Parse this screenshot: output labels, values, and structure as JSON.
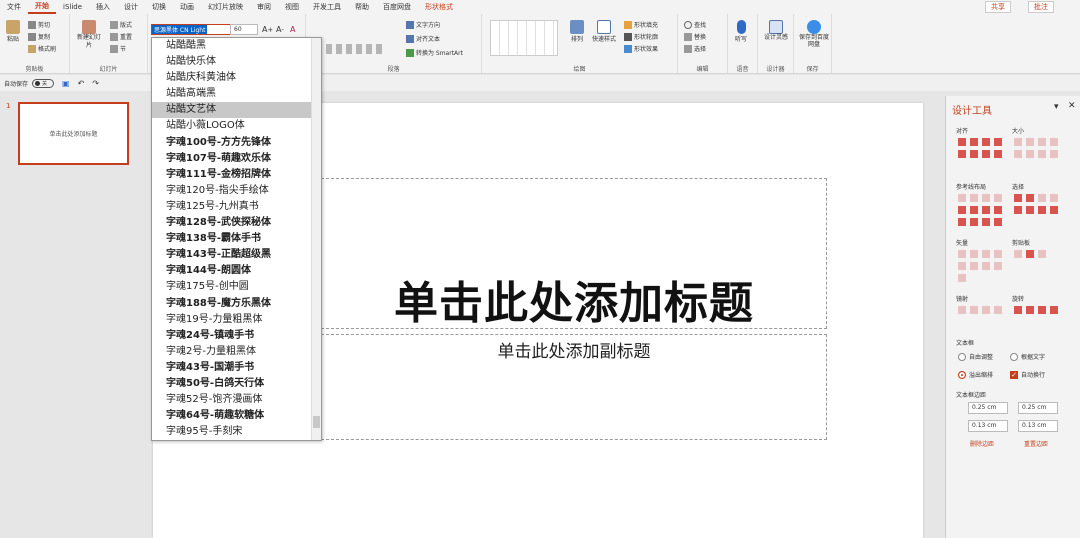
{
  "menu": [
    "文件",
    "开始",
    "iSlide",
    "插入",
    "设计",
    "切换",
    "动画",
    "幻灯片放映",
    "审阅",
    "视图",
    "开发工具",
    "帮助",
    "百度网盘",
    "形状格式"
  ],
  "menu_active": "开始",
  "menu_right": {
    "share": "共享",
    "comment": "批注"
  },
  "ribbon": {
    "clipboard": {
      "paste": "粘贴",
      "cut": "剪切",
      "copy": "复制",
      "format_painter": "格式刷",
      "label": "剪贴板"
    },
    "slides": {
      "new_slide": "新建幻灯片",
      "layout": "版式",
      "reset": "重置",
      "section": "节",
      "label": "幻灯片"
    },
    "font": {
      "family": "思源黑体 CN Light",
      "size": "60"
    },
    "paragraph": {
      "text_direction": "文字方向",
      "align_text": "对齐文本",
      "smartart": "转换为 SmartArt",
      "label": "段落"
    },
    "drawing": {
      "arrange": "排列",
      "quick_styles": "快速样式",
      "fill": "形状填充",
      "outline": "形状轮廓",
      "effect": "形状效果",
      "label": "绘图"
    },
    "editing": {
      "find": "查找",
      "replace": "替换",
      "select": "选择",
      "label": "编辑"
    },
    "voice": {
      "dictate": "听写",
      "label": "语音"
    },
    "designer": {
      "design_ideas": "设计灵感",
      "label": "设计器"
    },
    "save": {
      "save_to_baidu": "保存到百度网盘",
      "label": "保存"
    }
  },
  "qat": {
    "autosave": "自动保存",
    "autosave_state": "关"
  },
  "thumbs": [
    {
      "number": "1",
      "text": "单击此处添加标题"
    }
  ],
  "slide": {
    "title": "单击此处添加标题",
    "subtitle": "单击此处添加副标题"
  },
  "font_list": [
    "站酷酷黑",
    "站酷快乐体",
    "站酷庆科黄油体",
    "站酷高端黑",
    "站酷文艺体",
    "站酷小薇LOGO体",
    "字魂100号-方方先锋体",
    "字魂107号-萌趣欢乐体",
    "字魂111号-金榜招牌体",
    "字魂120号-指尖手绘体",
    "字魂125号-九州真书",
    "字魂128号-武侠探秘体",
    "字魂138号-霸体手书",
    "字魂143号-正酷超级黑",
    "字魂144号-朗圆体",
    "字魂175号-创中圆",
    "字魂188号-魔方乐黑体",
    "字魂19号-力量粗黑体",
    "字魂24号-镇魂手书",
    "字魂2号-力量粗黑体",
    "字魂43号-国潮手书",
    "字魂50号-白鸽天行体",
    "字魂52号-饱齐漫画体",
    "字魂64号-萌趣软糖体",
    "字魂95号-手刻宋"
  ],
  "font_selected_index": 4,
  "design_pane": {
    "title": "设计工具",
    "align": "对齐",
    "size": "大小",
    "guides": "参考线布局",
    "select": "选择",
    "vector": "矢量",
    "clipboard": "剪贴板",
    "mirror": "镜射",
    "rotate": "旋转",
    "textbox": "文本框",
    "autofit": "自由调整",
    "fit_text": "根据文字",
    "overflow": "溢出缩排",
    "wrap": "自动换行",
    "margins_label": "文本框边距",
    "margin_left": "0.25 cm",
    "margin_right": "0.25 cm",
    "margin_top": "0.13 cm",
    "margin_bottom": "0.13 cm",
    "delete_margin": "删除边距",
    "reset_margin": "重置边距"
  },
  "colors": {
    "accent": "#c43e1c"
  }
}
